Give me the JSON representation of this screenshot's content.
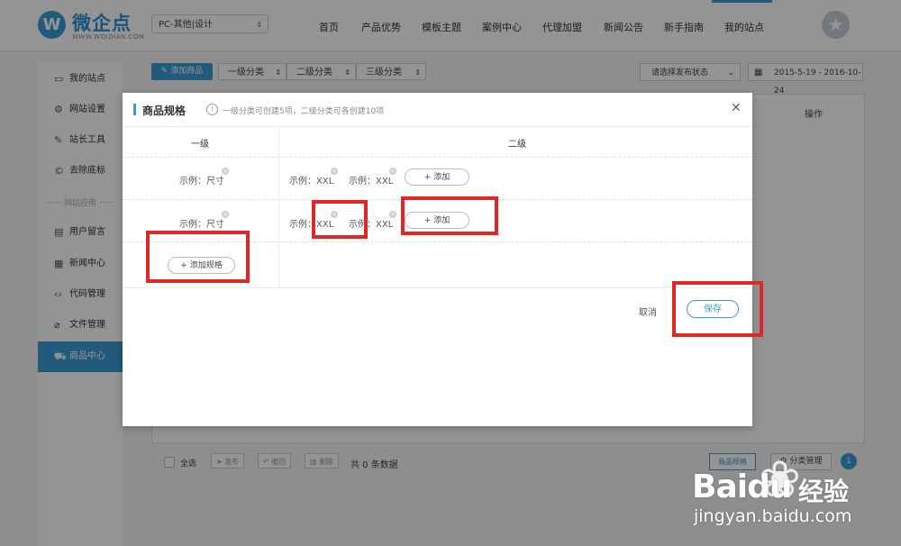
{
  "brand": {
    "name": "微企点",
    "sub": "WWW.WQIDIAN.COM",
    "mark": "W"
  },
  "site_select": {
    "value": "PC-其他|设计"
  },
  "nav": [
    "首页",
    "产品优势",
    "模板主题",
    "案例中心",
    "代理加盟",
    "新闻公告",
    "新手指南",
    "我的站点"
  ],
  "sidebar": {
    "items": [
      {
        "label": "我的站点",
        "icon": "monitor-icon"
      },
      {
        "label": "网站设置",
        "icon": "gear-icon"
      },
      {
        "label": "站长工具",
        "icon": "wrench-icon"
      },
      {
        "label": "去除底标",
        "icon": "copyright-icon"
      }
    ],
    "group_label": "网站应用",
    "apps": [
      {
        "label": "用户留言",
        "icon": "message-icon"
      },
      {
        "label": "新闻中心",
        "icon": "news-icon"
      },
      {
        "label": "代码管理",
        "icon": "code-icon"
      },
      {
        "label": "文件管理",
        "icon": "paperclip-icon"
      },
      {
        "label": "商品中心",
        "icon": "cart-icon",
        "active": true
      }
    ]
  },
  "toolbar": {
    "add_goods": "添加商品",
    "cat1": "一级分类",
    "cat2": "二级分类",
    "cat3": "三级分类",
    "status": "请选择发布状态",
    "date_range": "2015-5-19  -  2016-10-24"
  },
  "table": {
    "col_op": "操作"
  },
  "footer": {
    "select_all": "全选",
    "publish": "发布",
    "withdraw": "撤回",
    "delete": "删除",
    "total": "共 0 条数据",
    "spec_mgmt": "商品规格",
    "cat_mgmt": "分类管理",
    "page": "1"
  },
  "modal": {
    "title": "商品规格",
    "info": "!",
    "hint": "一级分类可创建5项，二级分类可各创建10项",
    "close": "✕",
    "col1": "一级",
    "col2": "二级",
    "rows": [
      {
        "level1": "示例：尺寸",
        "level2": [
          "示例：XXL",
          "示例：XXL"
        ],
        "add": "+ 添加"
      },
      {
        "level1": "示例：尺寸",
        "level2": [
          "示例：XXL",
          "示例：XXL"
        ],
        "add": "+ 添加"
      }
    ],
    "add_spec": "+ 添加规格",
    "cancel": "取消",
    "save": "保存"
  },
  "watermark": {
    "bai": "Bai",
    "du": "du",
    "jingyan": "经验",
    "url": "jingyan.baidu.com"
  },
  "colors": {
    "accent": "#3a9bd5",
    "highlight": "#e22525"
  }
}
